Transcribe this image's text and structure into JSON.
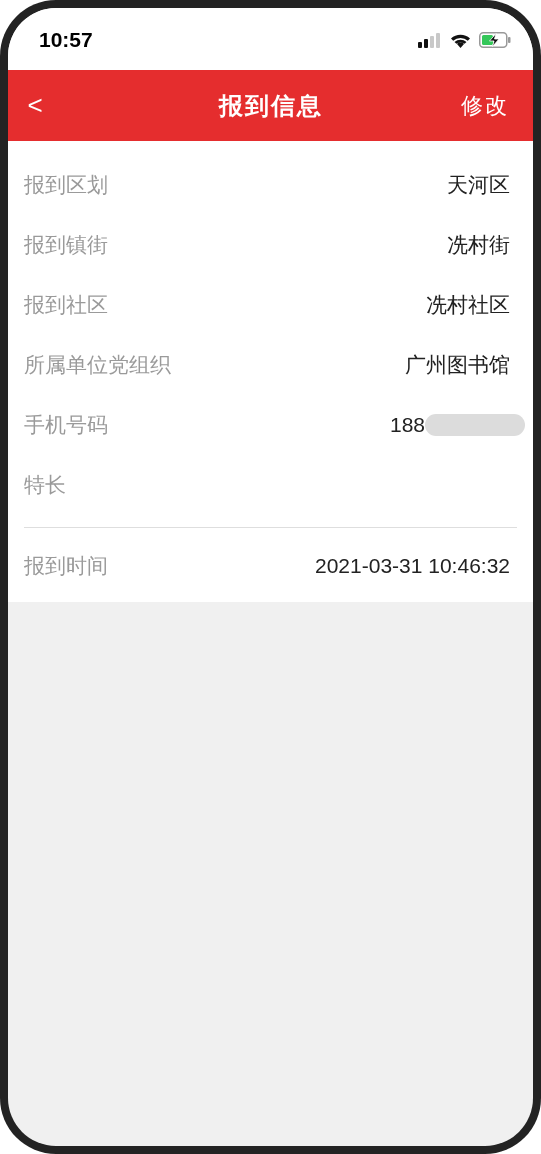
{
  "status_bar": {
    "time": "10:57"
  },
  "nav_bar": {
    "back": "<",
    "title": "报到信息",
    "action": "修改"
  },
  "fields": [
    {
      "label": "报到区划",
      "value": "天河区",
      "masked": false
    },
    {
      "label": "报到镇街",
      "value": "冼村街",
      "masked": false
    },
    {
      "label": "报到社区",
      "value": "冼村社区",
      "masked": false
    },
    {
      "label": "所属单位党组织",
      "value": "广州图书馆",
      "masked": false
    },
    {
      "label": "手机号码",
      "value": "188",
      "masked": true
    },
    {
      "label": "特长",
      "masked": false
    }
  ],
  "report_time": {
    "label": "报到时间",
    "value": "2021-03-31 10:46:32"
  }
}
